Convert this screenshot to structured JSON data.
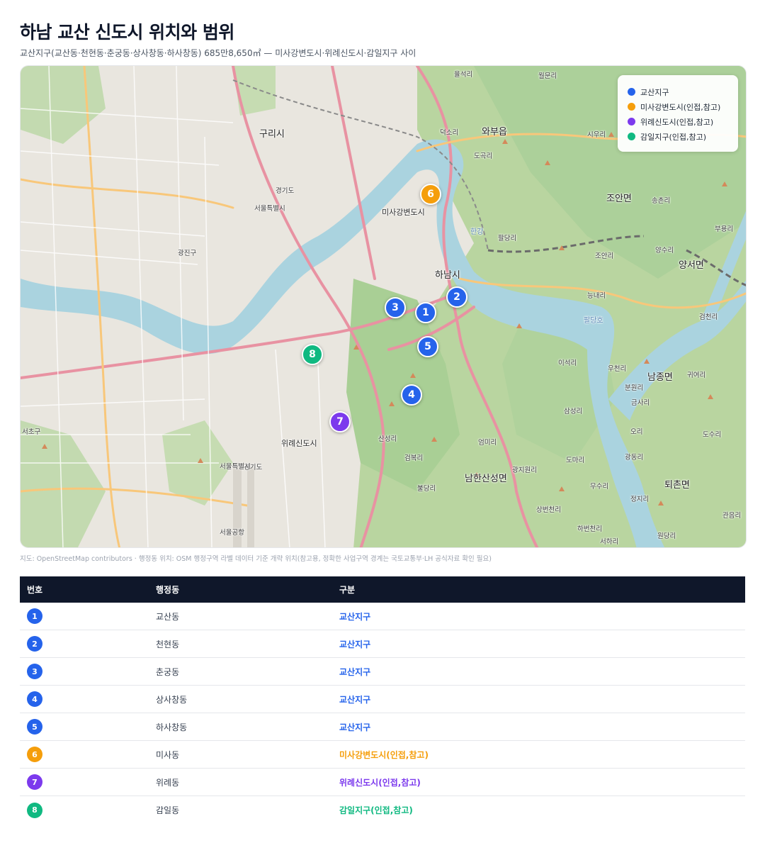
{
  "title": "하남 교산 신도시 위치와 범위",
  "subtitle": "교산지구(교산동·천현동·춘궁동·상사창동·하사창동) 685만8,650㎡ — 미사강변도시·위례신도시·감일지구 사이",
  "attribution": "지도: OpenStreetMap contributors · 행정동 위치: OSM 행정구역 라벨 데이터 기준 개략 위치(참고용, 정확한 사업구역 경계는 국토교통부·LH 공식자료 확인 필요)",
  "colors": {
    "gyosan": "#2563eb",
    "misa": "#f59e0b",
    "wirye": "#7c3aed",
    "gamil": "#10b981"
  },
  "legend": [
    {
      "label": "교산지구",
      "color": "#2563eb"
    },
    {
      "label": "미사강변도시(인접,참고)",
      "color": "#f59e0b"
    },
    {
      "label": "위례신도시(인접,참고)",
      "color": "#7c3aed"
    },
    {
      "label": "감일지구(인접,참고)",
      "color": "#10b981"
    }
  ],
  "markers": [
    {
      "num": "1",
      "color": "#2563eb"
    },
    {
      "num": "2",
      "color": "#2563eb"
    },
    {
      "num": "3",
      "color": "#2563eb"
    },
    {
      "num": "4",
      "color": "#2563eb"
    },
    {
      "num": "5",
      "color": "#2563eb"
    },
    {
      "num": "6",
      "color": "#f59e0b"
    },
    {
      "num": "7",
      "color": "#7c3aed"
    },
    {
      "num": "8",
      "color": "#10b981"
    }
  ],
  "map_labels": {
    "guri": "구리시",
    "wabu": "와부읍",
    "joan": "조안면",
    "misa_city": "미사강변도시",
    "hanam": "하남시",
    "yangseo": "양서면",
    "namjong": "남종면",
    "toechon": "퇴촌면",
    "namhansan": "남한산성면",
    "wirye_city": "위례신도시",
    "gwangjin": "광진구",
    "seocho": "서초구",
    "seoul_airport": "서울공항",
    "hangang": "한강",
    "paldang_lake": "팔당호",
    "yulseokri": "율석리",
    "wolmunri": "월문리",
    "deokso": "덕소리",
    "dogokri": "도곡리",
    "siuri": "시우리",
    "songchonri": "송촌리",
    "buyongri": "부용리",
    "paldangri": "팔당리",
    "joanri": "조안리",
    "yangsuri": "양수리",
    "neungnaeri": "능내리",
    "geomcheonri": "검천리",
    "isokri": "이석리",
    "ucheonri": "우천리",
    "bunwonri": "분원리",
    "geumsari": "금사리",
    "guiyeori": "귀여리",
    "orii": "오리",
    "dosuri": "도수리",
    "samseongri": "삼성리",
    "eommiri": "엄미리",
    "sanseongri": "산성리",
    "geombokri": "검복리",
    "buldangri": "불당리",
    "gwangjiwonri": "광지원리",
    "domari": "도마리",
    "gwangdongri": "광동리",
    "musuri": "무수리",
    "jeongjiri": "정지리",
    "sangbeoncheonri": "상번천리",
    "habeoncheonri": "하번천리",
    "seohari": "서하리",
    "gwaneumri": "관음리",
    "wondangri": "원당리",
    "gyeonggi_1": "경기도",
    "gyeonggi_2": "경기도",
    "seoul_1": "서울특별시",
    "seoul_2": "서울특별시"
  },
  "table": {
    "headers": [
      "번호",
      "행정동",
      "구분"
    ],
    "rows": [
      {
        "num": "1",
        "dong": "교산동",
        "type": "교산지구",
        "color": "#2563eb"
      },
      {
        "num": "2",
        "dong": "천현동",
        "type": "교산지구",
        "color": "#2563eb"
      },
      {
        "num": "3",
        "dong": "춘궁동",
        "type": "교산지구",
        "color": "#2563eb"
      },
      {
        "num": "4",
        "dong": "상사창동",
        "type": "교산지구",
        "color": "#2563eb"
      },
      {
        "num": "5",
        "dong": "하사창동",
        "type": "교산지구",
        "color": "#2563eb"
      },
      {
        "num": "6",
        "dong": "미사동",
        "type": "미사강변도시(인접,참고)",
        "color": "#f59e0b"
      },
      {
        "num": "7",
        "dong": "위례동",
        "type": "위례신도시(인접,참고)",
        "color": "#7c3aed"
      },
      {
        "num": "8",
        "dong": "감일동",
        "type": "감일지구(인접,참고)",
        "color": "#10b981"
      }
    ]
  }
}
